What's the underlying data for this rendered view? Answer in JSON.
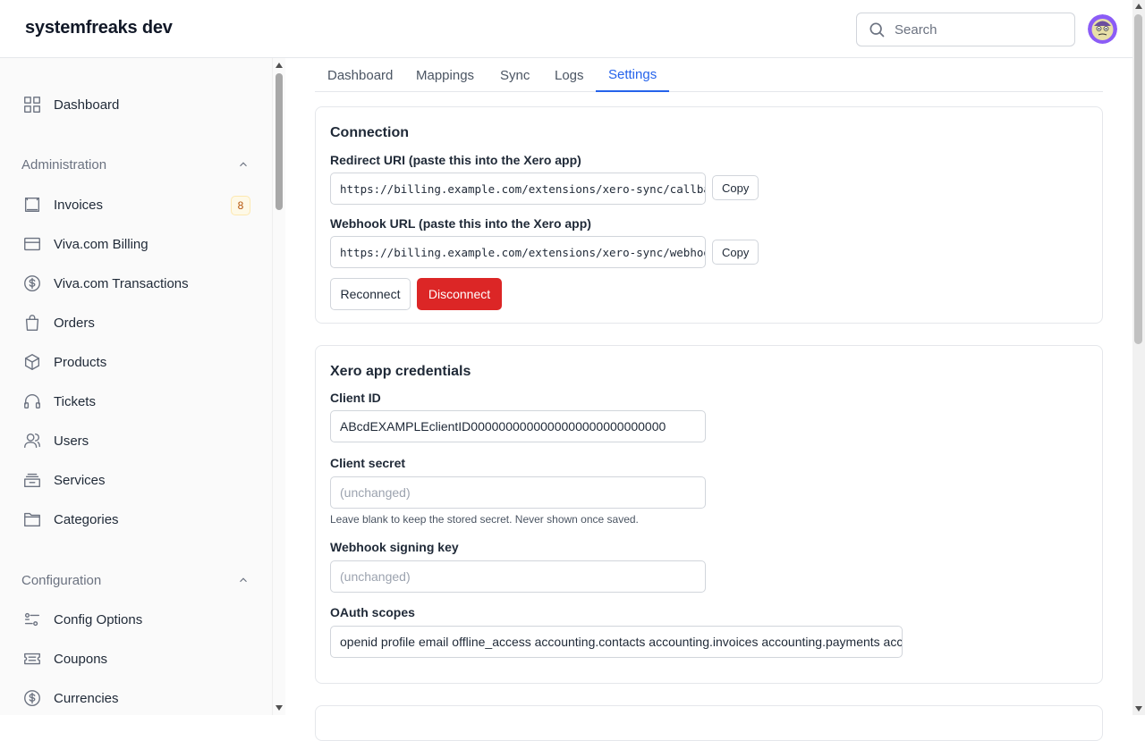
{
  "app": {
    "brand": "systemfreaks dev"
  },
  "search": {
    "placeholder": "Search"
  },
  "sidebar": {
    "dashboard": "Dashboard",
    "administration": {
      "title": "Administration",
      "items": [
        {
          "label": "Invoices",
          "icon": "invoice-icon",
          "badge": "8"
        },
        {
          "label": "Viva.com Billing",
          "icon": "credit-card-icon"
        },
        {
          "label": "Viva.com Transactions",
          "icon": "dollar-circle-icon"
        },
        {
          "label": "Orders",
          "icon": "shopping-bag-icon"
        },
        {
          "label": "Products",
          "icon": "cube-icon"
        },
        {
          "label": "Tickets",
          "icon": "headset-icon"
        },
        {
          "label": "Users",
          "icon": "users-icon"
        },
        {
          "label": "Services",
          "icon": "stack-icon"
        },
        {
          "label": "Categories",
          "icon": "folder-icon"
        }
      ]
    },
    "configuration": {
      "title": "Configuration",
      "items": [
        {
          "label": "Config Options",
          "icon": "sliders-icon"
        },
        {
          "label": "Coupons",
          "icon": "ticket-icon"
        },
        {
          "label": "Currencies",
          "icon": "dollar-circle-icon"
        }
      ]
    }
  },
  "tabs": [
    "Dashboard",
    "Mappings",
    "Sync",
    "Logs",
    "Settings"
  ],
  "active_tab": "Settings",
  "connection": {
    "title": "Connection",
    "redirect_label": "Redirect URI (paste this into the Xero app)",
    "redirect_value": "https://billing.example.com/extensions/xero-sync/callback",
    "webhook_label": "Webhook URL (paste this into the Xero app)",
    "webhook_value": "https://billing.example.com/extensions/xero-sync/webhook",
    "copy_label": "Copy",
    "reconnect_label": "Reconnect",
    "disconnect_label": "Disconnect"
  },
  "credentials": {
    "title": "Xero app credentials",
    "client_id_label": "Client ID",
    "client_id_value": "ABcdEXAMPLEclientID0000000000000000000000000000",
    "client_secret_label": "Client secret",
    "client_secret_placeholder": "(unchanged)",
    "client_secret_help": "Leave blank to keep the stored secret. Never shown once saved.",
    "webhook_key_label": "Webhook signing key",
    "webhook_key_placeholder": "(unchanged)",
    "scopes_label": "OAuth scopes",
    "scopes_value": "openid profile email offline_access accounting.contacts accounting.invoices accounting.payments accounting.settings"
  },
  "colors": {
    "accent": "#2563eb",
    "danger": "#dc2626",
    "badge_bg": "#fef9e7",
    "badge_text": "#b45309"
  }
}
